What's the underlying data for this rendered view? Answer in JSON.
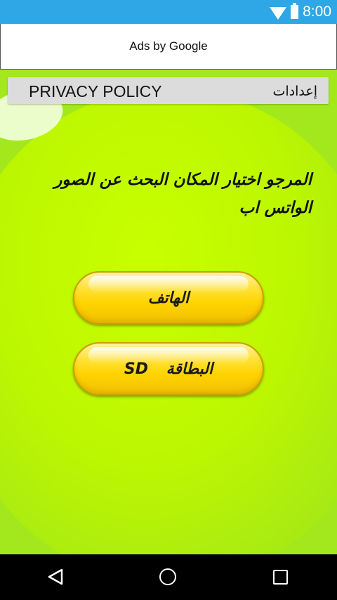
{
  "status_bar": {
    "time": "8:00",
    "wifi_icon": "wifi-icon",
    "battery_icon": "battery-icon",
    "color": "#2fa7e6"
  },
  "ad_banner": {
    "text": "Ads by Google"
  },
  "menu": {
    "privacy_label": "PRIVACY POLICY",
    "settings_label": "إعدادات"
  },
  "main": {
    "instruction": "المرجو اختيار المكان البحث عن الصور الواتس اب",
    "buttons": [
      {
        "label": "الهاتف"
      },
      {
        "label": "البطاقة SD"
      }
    ],
    "accent_color": "#ffd400",
    "background_color": "#bcf601"
  },
  "nav_bar": {
    "back_icon": "back-triangle-icon",
    "home_icon": "home-circle-icon",
    "recent_icon": "recent-apps-square-icon"
  }
}
